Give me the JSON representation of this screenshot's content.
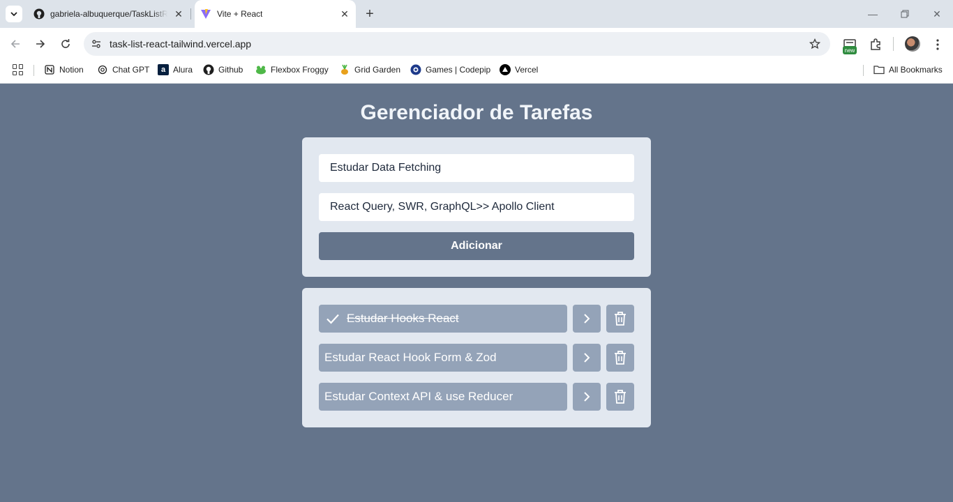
{
  "browser": {
    "tabs": [
      {
        "title": "gabriela-albuquerque/TaskListReact",
        "favicon": "github-icon",
        "active": false
      },
      {
        "title": "Vite + React",
        "favicon": "vite-icon",
        "active": true
      }
    ],
    "url": "task-list-react-tailwind.vercel.app",
    "new_badge": "new",
    "bookmarks": [
      {
        "label": "Notion",
        "icon": "notion-icon"
      },
      {
        "label": "Chat GPT",
        "icon": "openai-icon"
      },
      {
        "label": "Alura",
        "icon": "alura-icon"
      },
      {
        "label": "Github",
        "icon": "github-icon"
      },
      {
        "label": "Flexbox Froggy",
        "icon": "frog-icon"
      },
      {
        "label": "Grid Garden",
        "icon": "carrot-icon"
      },
      {
        "label": "Games | Codepip",
        "icon": "codepip-icon"
      },
      {
        "label": "Vercel",
        "icon": "vercel-icon"
      }
    ],
    "all_bookmarks": "All Bookmarks"
  },
  "app": {
    "title": "Gerenciador de Tarefas",
    "form": {
      "title_value": "Estudar Data Fetching",
      "description_value": "React Query, SWR, GraphQL>> Apollo Client",
      "submit_label": "Adicionar"
    },
    "tasks": [
      {
        "title": "Estudar Hooks React",
        "completed": true
      },
      {
        "title": "Estudar React Hook Form & Zod",
        "completed": false
      },
      {
        "title": "Estudar Context API & use Reducer",
        "completed": false
      }
    ]
  },
  "colors": {
    "page_bg": "#64748b",
    "card_bg": "#e2e8f0",
    "task_bg": "#94a3b8",
    "button_bg": "#64748b",
    "title_text": "#f1f5f9"
  }
}
